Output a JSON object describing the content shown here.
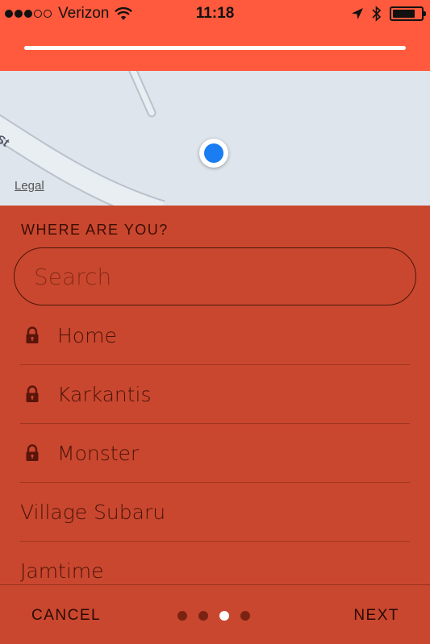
{
  "status_bar": {
    "carrier": "Verizon",
    "time": "11:18",
    "signal_bars": 3,
    "signal_max": 5,
    "battery_level": 0.8
  },
  "header": {
    "progress": 1.0
  },
  "map": {
    "legal_label": "Legal",
    "street_fragment": "St"
  },
  "panel": {
    "title": "WHERE ARE YOU?",
    "search_placeholder": "Search"
  },
  "locations": [
    {
      "label": "Home",
      "locked": true
    },
    {
      "label": "Karkantis",
      "locked": true
    },
    {
      "label": "Monster",
      "locked": true
    },
    {
      "label": "Village Subaru",
      "locked": false
    },
    {
      "label": "Jamtime",
      "locked": false
    }
  ],
  "footer": {
    "cancel_label": "CANCEL",
    "next_label": "NEXT",
    "page_count": 4,
    "current_page": 3
  },
  "colors": {
    "header": "#ff5a3d",
    "panel": "#c9472e",
    "location_dot": "#1a7df2",
    "map_bg": "#dfe5ec"
  }
}
